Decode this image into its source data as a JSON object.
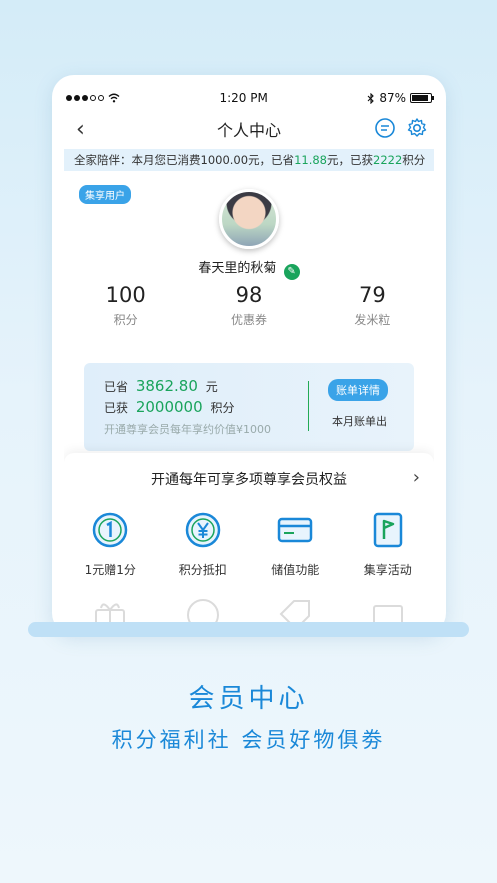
{
  "status_bar": {
    "time": "1:20 PM",
    "battery": "87%"
  },
  "nav": {
    "title": "个人中心",
    "back_icon": "‹"
  },
  "banner": {
    "prefix": "全家陪伴：本月您已消费",
    "spent": "1000.00",
    "mid1": "元，已省",
    "saved": "11.88",
    "mid2": "元，已获",
    "points": "2222",
    "suffix": "积分"
  },
  "profile": {
    "tag": "集享用户",
    "name": "春天里的秋菊"
  },
  "stats": [
    {
      "num": "100",
      "label": "积分"
    },
    {
      "num": "98",
      "label": "优惠券"
    },
    {
      "num": "79",
      "label": "发米粒"
    }
  ],
  "saving": {
    "saved_label": "已省",
    "saved_value": "3862.80",
    "saved_unit": "元",
    "got_label": "已获",
    "got_value": "2000000",
    "got_unit": "积分",
    "note": "开通尊享会员每年享约价值¥1000",
    "detail_button": "账单详情",
    "month_bill": "本月账单出"
  },
  "benefits": {
    "title": "开通每年可享多项尊享会员权益",
    "items": [
      {
        "label": "1元赠1分",
        "icon": "one-coin-icon"
      },
      {
        "label": "积分抵扣",
        "icon": "yen-coin-icon"
      },
      {
        "label": "储值功能",
        "icon": "card-icon"
      },
      {
        "label": "集享活动",
        "icon": "flag-icon"
      }
    ]
  },
  "footer": {
    "title": "会员中心",
    "subtitle": "积分福利社 会员好物俱劵"
  },
  "colors": {
    "accent_blue": "#1a88d8",
    "accent_green": "#1aa45c",
    "tag_blue": "#3aa3e8"
  }
}
